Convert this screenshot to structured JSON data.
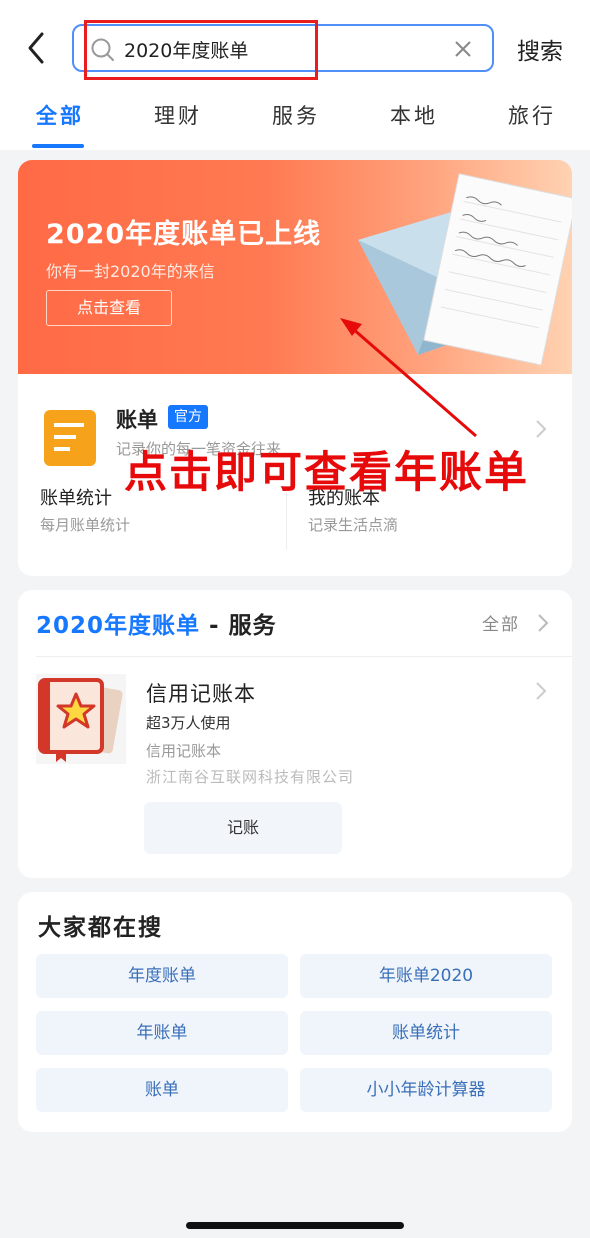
{
  "search": {
    "value": "2020年度账单",
    "button_label": "搜索"
  },
  "tabs": [
    {
      "label": "全部",
      "active": true
    },
    {
      "label": "理财"
    },
    {
      "label": "服务"
    },
    {
      "label": "本地"
    },
    {
      "label": "旅行"
    }
  ],
  "banner": {
    "title": "2020年度账单已上线",
    "subtitle": "你有一封2020年的来信",
    "button_label": "点击查看"
  },
  "app": {
    "name": "账单",
    "badge": "官方",
    "description": "记录你的每一笔资金往来",
    "sub_items": [
      {
        "title": "账单统计",
        "desc": "每月账单统计"
      },
      {
        "title": "我的账本",
        "desc": "记录生活点滴"
      }
    ]
  },
  "annotation": {
    "text": "点击即可查看年账单"
  },
  "service_section": {
    "title_keyword": "2020年度账单",
    "title_rest": " - 服务",
    "all_label": "全部",
    "item": {
      "name": "信用记账本",
      "users": "超3万人使用",
      "category": "信用记账本",
      "company": "浙江南谷互联网科技有限公司",
      "action_label": "记账"
    }
  },
  "hot_search": {
    "title": "大家都在搜",
    "items": [
      "年度账单",
      "年账单2020",
      "年账单",
      "账单统计",
      "账单",
      "小小年龄计算器"
    ]
  },
  "colors": {
    "accent": "#1677ff",
    "banner": "#ff6a45",
    "annotation": "#e60a0a"
  },
  "icons": [
    "back-arrow-icon",
    "search-icon",
    "clear-icon",
    "bill-app-icon",
    "chevron-right-icon",
    "notebook-star-icon"
  ]
}
